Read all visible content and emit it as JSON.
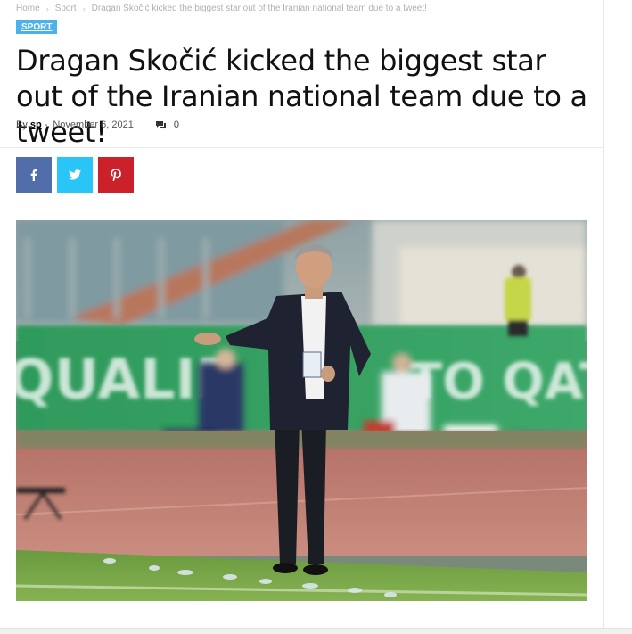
{
  "breadcrumb": {
    "items": [
      "Home",
      "Sport",
      "Dragan Skočić kicked the biggest star out of the Iranian national team due to a tweet!"
    ]
  },
  "article": {
    "category": "SPORT",
    "title": "Dragan Skočić kicked the biggest star out of the Iranian national team due to a tweet!",
    "by_label": "By",
    "author": "sp",
    "separator": "-",
    "date": "November 6, 2021",
    "comment_count": "0"
  },
  "share": {
    "buttons": [
      {
        "network": "facebook",
        "icon": "facebook-icon",
        "color": "#516eab"
      },
      {
        "network": "twitter",
        "icon": "twitter-icon",
        "color": "#29c5f6"
      },
      {
        "network": "pinterest",
        "icon": "pinterest-icon",
        "color": "#ca212a"
      }
    ]
  },
  "colors": {
    "accent": "#4db2ec"
  }
}
